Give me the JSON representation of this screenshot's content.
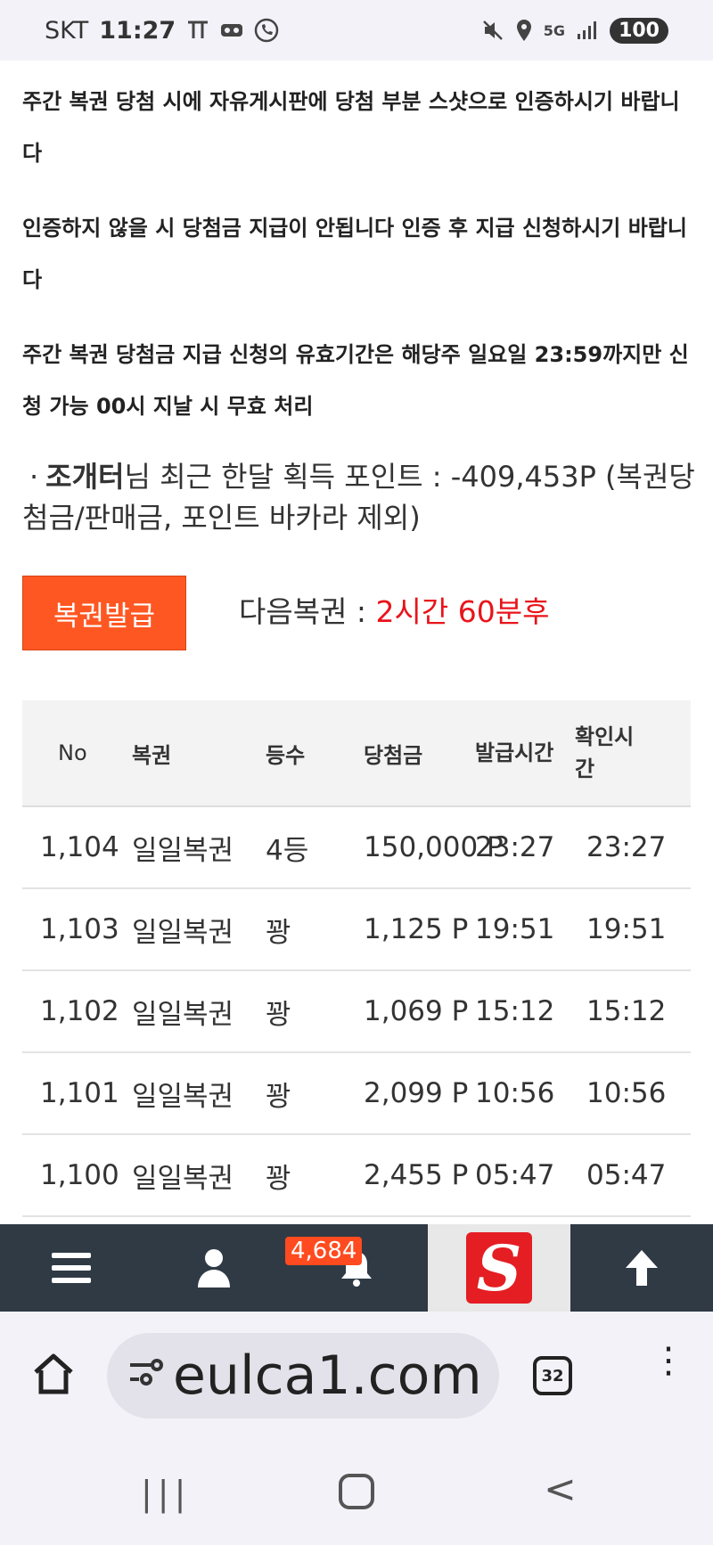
{
  "status": {
    "carrier": "SKT",
    "time": "11:27",
    "battery": "100",
    "network": "5G"
  },
  "notices": [
    "주간 복권 당첨 시에 자유게시판에 당첨 부분 스샷으로 인증하시기 바랍니다",
    "인증하지 않을 시 당첨금 지급이 안됩니다 인증 후 지급 신청하시기 바랍니다",
    "주간 복권 당첨금 지급 신청의 유효기간은 해당주 일요일 23:59까지만 신청 가능 00시 지날 시 무효 처리"
  ],
  "points": {
    "bullet": "·",
    "name": "조개터",
    "text": "님 최근 한달 획득 포인트 : -409,453P (복권당첨금/판매금, 포인트 바카라 제외)"
  },
  "issue_button": "복권발급",
  "next_lottery": {
    "label": "다음복권 : ",
    "value": "2시간 60분후"
  },
  "table": {
    "headers": [
      "No",
      "복권",
      "등수",
      "당첨금",
      "발급시간",
      "확인시간"
    ],
    "rows": [
      {
        "no": "1,104",
        "lottery": "일일복권",
        "rank": "4등",
        "prize": "150,000 P",
        "issued": "23:27",
        "checked": "23:27"
      },
      {
        "no": "1,103",
        "lottery": "일일복권",
        "rank": "꽝",
        "prize": "1,125 P",
        "issued": "19:51",
        "checked": "19:51"
      },
      {
        "no": "1,102",
        "lottery": "일일복권",
        "rank": "꽝",
        "prize": "1,069 P",
        "issued": "15:12",
        "checked": "15:12"
      },
      {
        "no": "1,101",
        "lottery": "일일복권",
        "rank": "꽝",
        "prize": "2,099 P",
        "issued": "10:56",
        "checked": "10:56"
      },
      {
        "no": "1,100",
        "lottery": "일일복권",
        "rank": "꽝",
        "prize": "2,455 P",
        "issued": "05:47",
        "checked": "05:47"
      }
    ]
  },
  "appnav": {
    "badge": "4,684",
    "items": [
      "menu-icon",
      "user-icon",
      "bell-icon",
      "site-logo",
      "arrow-up-icon"
    ]
  },
  "browser": {
    "url": "eulca1.com",
    "tab_count": "32"
  },
  "colors": {
    "accent": "#ff5722",
    "highlight": "#e8141b",
    "nav_bg": "#2f3a45"
  }
}
